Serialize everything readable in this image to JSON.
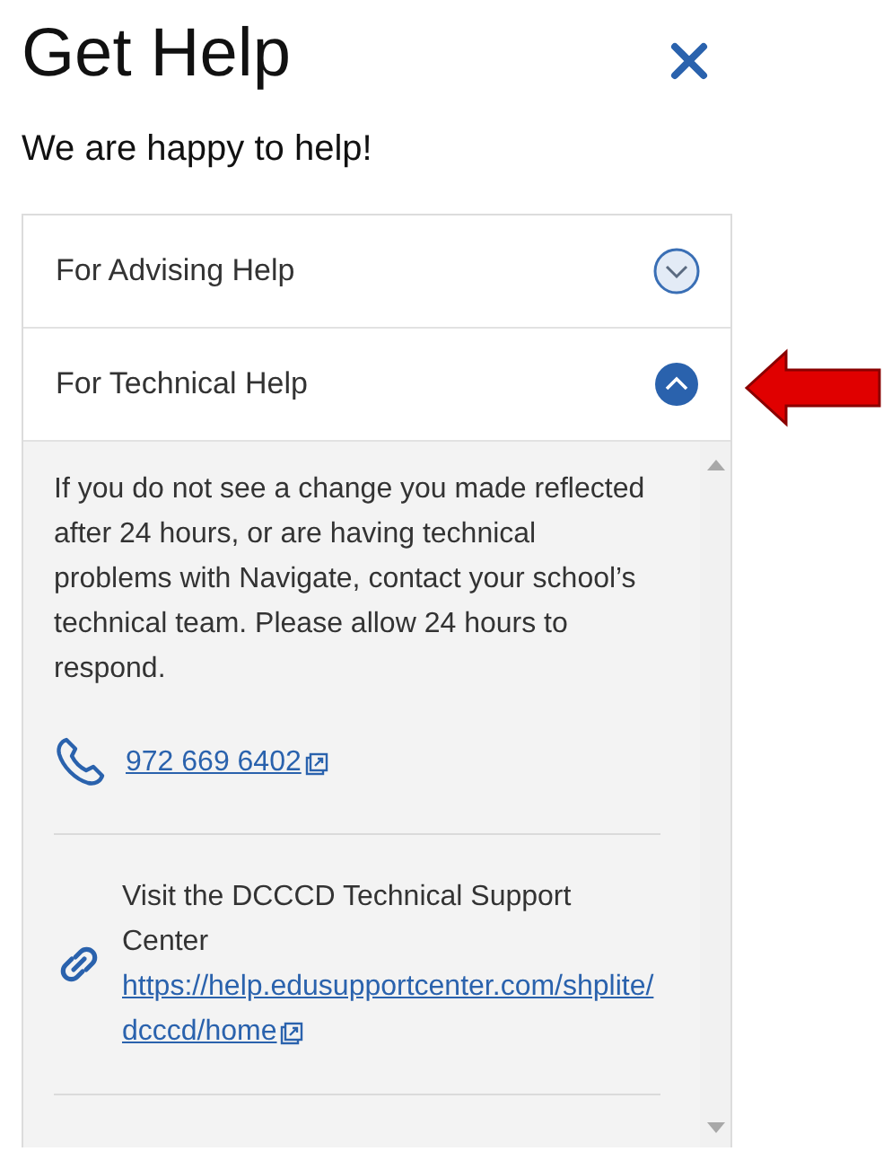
{
  "title": "Get Help",
  "subtitle": "We are happy to help!",
  "sections": [
    {
      "label": "For Advising Help",
      "expanded": false
    },
    {
      "label": "For Technical Help",
      "expanded": true,
      "body": "If you do not see a change you made reflected after 24 hours, or are having technical problems with Navigate, contact your school’s technical team. Please allow 24 hours to respond.",
      "contacts": [
        {
          "kind": "phone",
          "link": "972 669 6402"
        },
        {
          "kind": "web",
          "text": "Visit the DCCCD Technical Support Center",
          "link": "https://help.edusupportcenter.com/shplite/dcccd/home"
        }
      ]
    }
  ],
  "annotation": {
    "kind": "arrow"
  }
}
